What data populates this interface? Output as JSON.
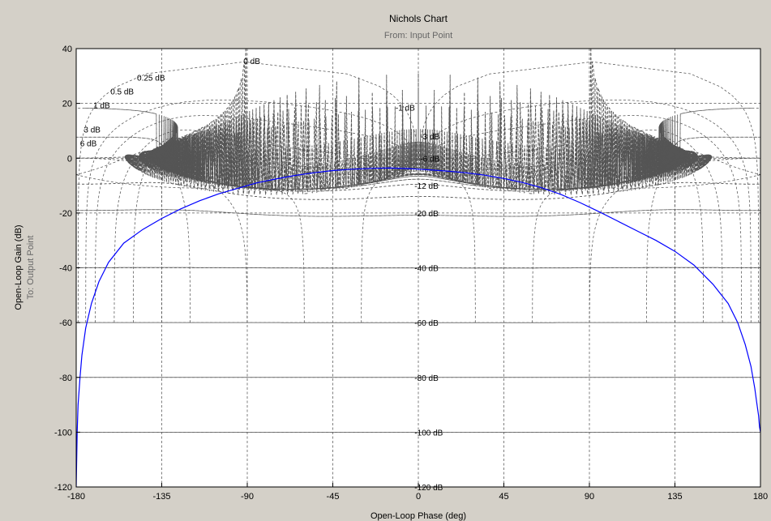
{
  "chart_data": {
    "type": "line",
    "title": "Nichols Chart",
    "subtitle": "From: Input Point",
    "xlabel": "Open-Loop Phase (deg)",
    "ylabel": "Open-Loop Gain (dB)",
    "ylabel2": "To: Output Point",
    "xlim": [
      -180,
      180
    ],
    "ylim": [
      -120,
      40
    ],
    "xticks": [
      -180,
      -135,
      -90,
      -45,
      0,
      45,
      90,
      135,
      180
    ],
    "yticks": [
      -120,
      -100,
      -80,
      -60,
      -40,
      -20,
      0,
      20,
      40
    ],
    "grid": true,
    "m_labels": [
      "0 dB",
      "0.25 dB",
      "0.5 dB",
      "1 dB",
      "3 dB",
      "6 dB",
      "-1 dB",
      "-3 dB",
      "-6 dB",
      "-12 dB",
      "-20 dB",
      "-40 dB",
      "-60 dB",
      "-80 dB",
      "-100 dB",
      "-120 dB"
    ],
    "series": [
      {
        "color": "#0000ff",
        "x": [
          -180,
          -179.5,
          -179,
          -178,
          -177,
          -175,
          -172,
          -168,
          -163,
          -155,
          -145,
          -135,
          -125,
          -115,
          -105,
          -95,
          -85,
          -75,
          -65,
          -55,
          -45,
          -35,
          -25,
          -15,
          -5,
          5,
          15,
          25,
          35,
          45,
          55,
          65,
          75,
          85,
          95,
          105,
          115,
          125,
          135,
          145,
          155,
          163,
          168,
          172,
          175,
          177,
          178,
          179,
          179.5,
          180
        ],
        "y": [
          -120,
          -100,
          -90,
          -80,
          -72,
          -62,
          -53,
          -45,
          -38,
          -31,
          -26,
          -22,
          -18.5,
          -15.5,
          -13,
          -11,
          -9,
          -7.6,
          -6.3,
          -5.3,
          -4.5,
          -4,
          -3.7,
          -3.6,
          -3.8,
          -4.2,
          -4.7,
          -5.3,
          -6.2,
          -7.4,
          -8.9,
          -10.8,
          -13.2,
          -16.2,
          -19.5,
          -23,
          -26.5,
          -30,
          -34,
          -39,
          -46,
          -53,
          -60,
          -68,
          -76,
          -84,
          -89,
          -94,
          -98,
          -100
        ]
      }
    ]
  }
}
